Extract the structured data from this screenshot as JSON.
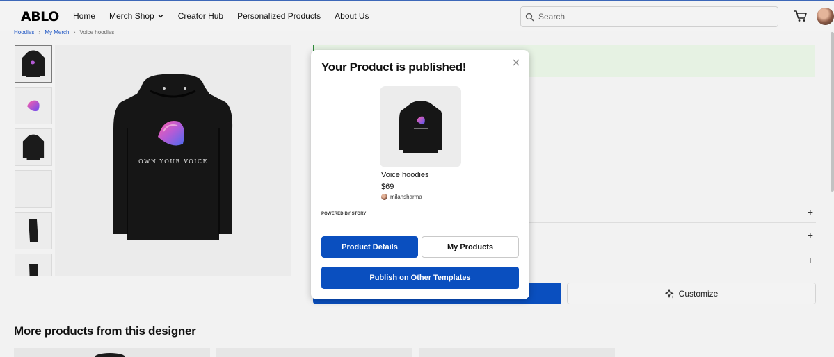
{
  "header": {
    "logo": "ABLO",
    "nav": [
      {
        "label": "Home"
      },
      {
        "label": "Merch Shop"
      },
      {
        "label": "Creator Hub"
      },
      {
        "label": "Personalized Products"
      },
      {
        "label": "About Us"
      }
    ],
    "search_placeholder": "Search"
  },
  "breadcrumb": {
    "items": [
      "Hoodies",
      "My Merch"
    ],
    "current": "Voice hoodies"
  },
  "product": {
    "graphic_text": "OWN YOUR VOICE"
  },
  "actions": {
    "customize_label": "Customize"
  },
  "more_section": {
    "title": "More products from this designer"
  },
  "modal": {
    "title": "Your Product is published!",
    "product_name": "Voice hoodies",
    "price": "$69",
    "username": "milansharma",
    "powered_by": "POWERED BY STORY",
    "btn_details": "Product Details",
    "btn_my_products": "My Products",
    "btn_publish": "Publish on Other Templates"
  },
  "colors": {
    "primary": "#0a4fbf",
    "success_bg": "#e6f2e3",
    "page_bg": "#f2f2f2"
  }
}
